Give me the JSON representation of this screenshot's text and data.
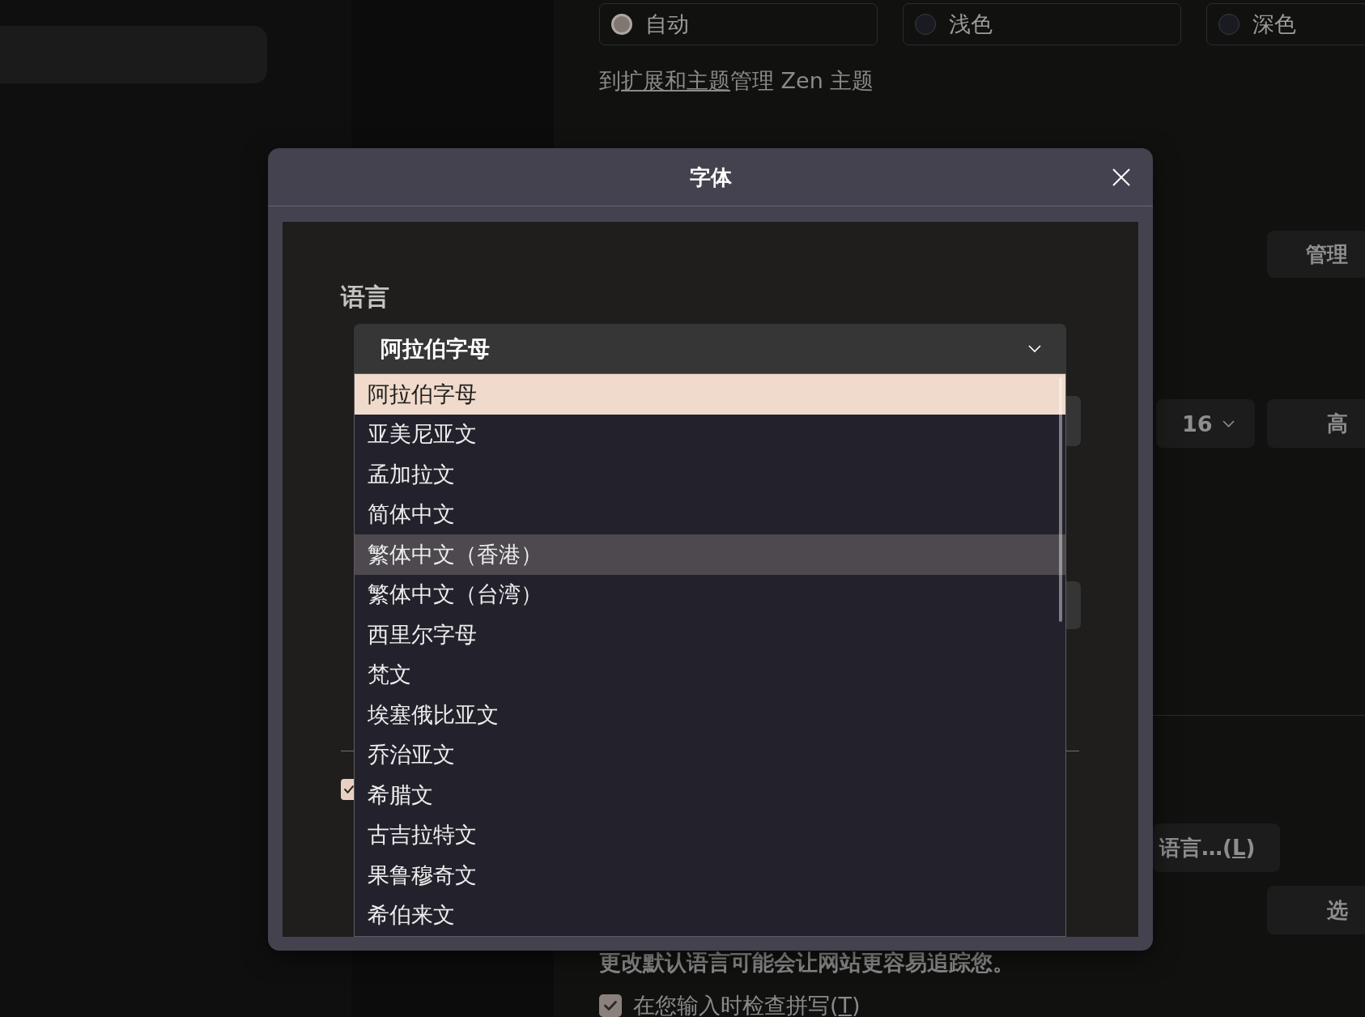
{
  "appearance": {
    "options": [
      {
        "label": "自动",
        "selected": true
      },
      {
        "label": "浅色",
        "selected": false
      },
      {
        "label": "深色",
        "selected": false
      }
    ],
    "note": {
      "before": "到",
      "link": "扩展和主题",
      "after": "管理 Zen 主题"
    }
  },
  "colors": {
    "manage_button": "管理"
  },
  "fonts": {
    "size_select": {
      "value": "16"
    },
    "advanced_button": "高"
  },
  "language": {
    "button": {
      "label": "语言…(",
      "access_key": "L",
      "after": ")"
    },
    "choose_button": "选",
    "warning": "更改默认语言可能会让网站更容易追踪您。",
    "spellcheck": {
      "checked": true,
      "label": "在您输入时检查拼写(",
      "access_key": "T",
      "after": ")"
    }
  },
  "dialog": {
    "title": "字体",
    "language_label": "语言",
    "language_select": {
      "value": "阿拉伯字母",
      "expanded": true,
      "options": [
        {
          "label": "阿拉伯字母",
          "selected": true,
          "hovered": false
        },
        {
          "label": "亚美尼亚文",
          "selected": false,
          "hovered": false
        },
        {
          "label": "孟加拉文",
          "selected": false,
          "hovered": false
        },
        {
          "label": "简体中文",
          "selected": false,
          "hovered": false
        },
        {
          "label": "繁体中文（香港）",
          "selected": false,
          "hovered": true
        },
        {
          "label": "繁体中文（台湾）",
          "selected": false,
          "hovered": false
        },
        {
          "label": "西里尔字母",
          "selected": false,
          "hovered": false
        },
        {
          "label": "梵文",
          "selected": false,
          "hovered": false
        },
        {
          "label": "埃塞俄比亚文",
          "selected": false,
          "hovered": false
        },
        {
          "label": "乔治亚文",
          "selected": false,
          "hovered": false
        },
        {
          "label": "希腊文",
          "selected": false,
          "hovered": false
        },
        {
          "label": "古吉拉特文",
          "selected": false,
          "hovered": false
        },
        {
          "label": "果鲁穆奇文",
          "selected": false,
          "hovered": false
        },
        {
          "label": "希伯来文",
          "selected": false,
          "hovered": false
        }
      ]
    },
    "checkbox": {
      "checked": true
    }
  }
}
